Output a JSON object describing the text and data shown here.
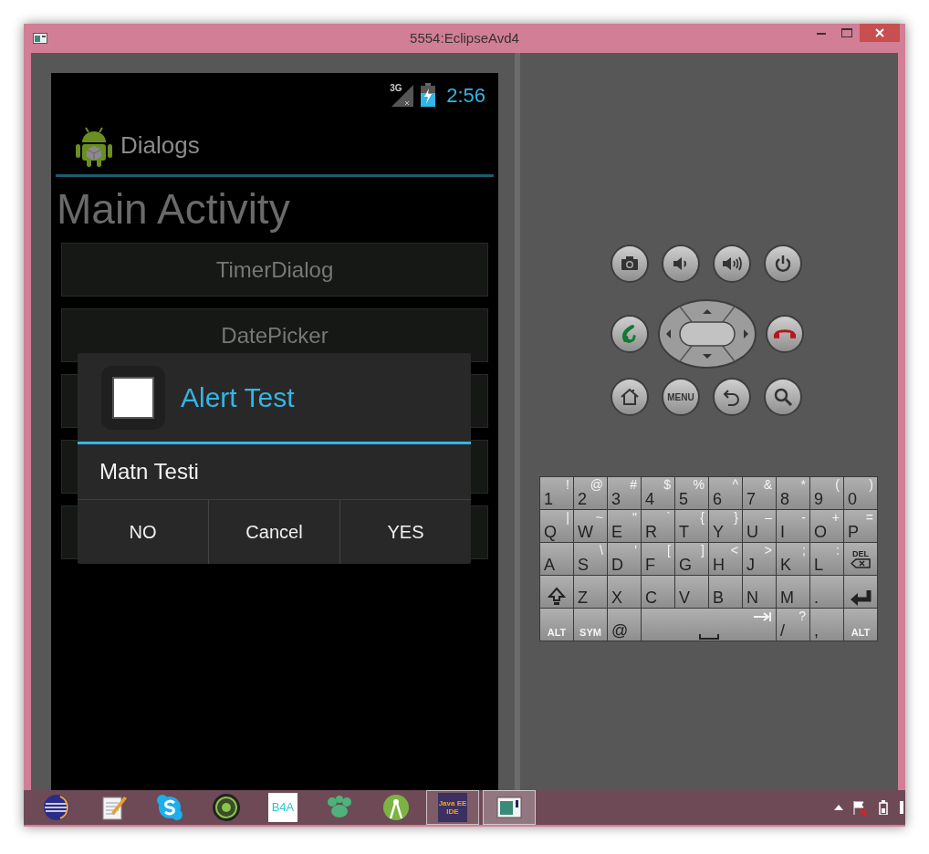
{
  "window": {
    "title": "5554:EclipseAvd4"
  },
  "phone": {
    "status_bar": {
      "network": "3G",
      "time": "2:56"
    },
    "action_bar": {
      "title": "Dialogs"
    },
    "heading": "Main Activity",
    "buttons": [
      {
        "kind": "labeled",
        "label": "TimerDialog"
      },
      {
        "kind": "labeled",
        "label": "DatePicker"
      },
      {
        "kind": "covered"
      },
      {
        "kind": "covered"
      },
      {
        "kind": "covered"
      }
    ],
    "dialog": {
      "title": "Alert Test",
      "message": "Matn Testi",
      "buttons": [
        "NO",
        "Cancel",
        "YES"
      ]
    }
  },
  "controls": {
    "rows": [
      [
        {
          "kind": "camera"
        },
        {
          "kind": "volume-down"
        },
        {
          "kind": "volume-up"
        },
        {
          "kind": "power"
        }
      ],
      [
        {
          "kind": "call"
        },
        {
          "kind": "dpad"
        },
        {
          "kind": "end-call"
        }
      ],
      [
        {
          "kind": "home"
        },
        {
          "kind": "menu",
          "label": "MENU"
        },
        {
          "kind": "back"
        },
        {
          "kind": "search"
        }
      ]
    ]
  },
  "keyboard": {
    "rows": [
      [
        {
          "kind": "char",
          "main": "1",
          "alt": "!"
        },
        {
          "kind": "char",
          "main": "2",
          "alt": "@"
        },
        {
          "kind": "char",
          "main": "3",
          "alt": "#"
        },
        {
          "kind": "char",
          "main": "4",
          "alt": "$"
        },
        {
          "kind": "char",
          "main": "5",
          "alt": "%"
        },
        {
          "kind": "char",
          "main": "6",
          "alt": "^"
        },
        {
          "kind": "char",
          "main": "7",
          "alt": "&"
        },
        {
          "kind": "char",
          "main": "8",
          "alt": "*"
        },
        {
          "kind": "char",
          "main": "9",
          "alt": "("
        },
        {
          "kind": "char",
          "main": "0",
          "alt": ")"
        }
      ],
      [
        {
          "kind": "char",
          "main": "Q",
          "alt": "|"
        },
        {
          "kind": "char",
          "main": "W",
          "alt": "~"
        },
        {
          "kind": "char",
          "main": "E",
          "alt": "\""
        },
        {
          "kind": "char",
          "main": "R",
          "alt": "`"
        },
        {
          "kind": "char",
          "main": "T",
          "alt": "{"
        },
        {
          "kind": "char",
          "main": "Y",
          "alt": "}"
        },
        {
          "kind": "char",
          "main": "U",
          "alt": "–"
        },
        {
          "kind": "char",
          "main": "I",
          "alt": "-"
        },
        {
          "kind": "char",
          "main": "O",
          "alt": "+"
        },
        {
          "kind": "char",
          "main": "P",
          "alt": "="
        }
      ],
      [
        {
          "kind": "char",
          "main": "A"
        },
        {
          "kind": "char",
          "main": "S",
          "alt": "\\"
        },
        {
          "kind": "char",
          "main": "D",
          "alt": "'"
        },
        {
          "kind": "char",
          "main": "F",
          "alt": "["
        },
        {
          "kind": "char",
          "main": "G",
          "alt": "]"
        },
        {
          "kind": "char",
          "main": "H",
          "alt": "<"
        },
        {
          "kind": "char",
          "main": "J",
          "alt": ">"
        },
        {
          "kind": "char",
          "main": "K",
          "alt": ";"
        },
        {
          "kind": "char",
          "main": "L",
          "alt": ":"
        },
        {
          "kind": "delete",
          "main": "DEL"
        }
      ],
      [
        {
          "kind": "shift"
        },
        {
          "kind": "char",
          "main": "Z"
        },
        {
          "kind": "char",
          "main": "X"
        },
        {
          "kind": "char",
          "main": "C"
        },
        {
          "kind": "char",
          "main": "V"
        },
        {
          "kind": "char",
          "main": "B"
        },
        {
          "kind": "char",
          "main": "N"
        },
        {
          "kind": "char",
          "main": "M"
        },
        {
          "kind": "char",
          "main": "."
        },
        {
          "kind": "enter"
        }
      ],
      [
        {
          "kind": "mod",
          "main": "ALT"
        },
        {
          "kind": "mod",
          "main": "SYM"
        },
        {
          "kind": "char",
          "main": "@"
        },
        {
          "kind": "space"
        },
        "",
        "",
        "",
        {
          "kind": "char",
          "main": "/",
          "alt": "?"
        },
        {
          "kind": "char",
          "main": ","
        },
        {
          "kind": "mod",
          "main": "ALT"
        }
      ]
    ]
  },
  "taskbar": {
    "items": [
      {
        "kind": "sphere",
        "running": false,
        "selected": false
      },
      {
        "kind": "notepad",
        "running": false,
        "selected": false
      },
      {
        "kind": "chat",
        "running": false,
        "selected": false
      },
      {
        "kind": "recorder",
        "running": false,
        "selected": false
      },
      {
        "kind": "b4a",
        "text": "B4A",
        "running": false,
        "selected": false
      },
      {
        "kind": "paw",
        "running": false,
        "selected": false
      },
      {
        "kind": "studio",
        "running": false,
        "selected": false
      },
      {
        "kind": "javaee",
        "text": "Java EE IDE",
        "running": true,
        "selected": false
      },
      {
        "kind": "emulator",
        "running": true,
        "selected": true
      }
    ]
  }
}
